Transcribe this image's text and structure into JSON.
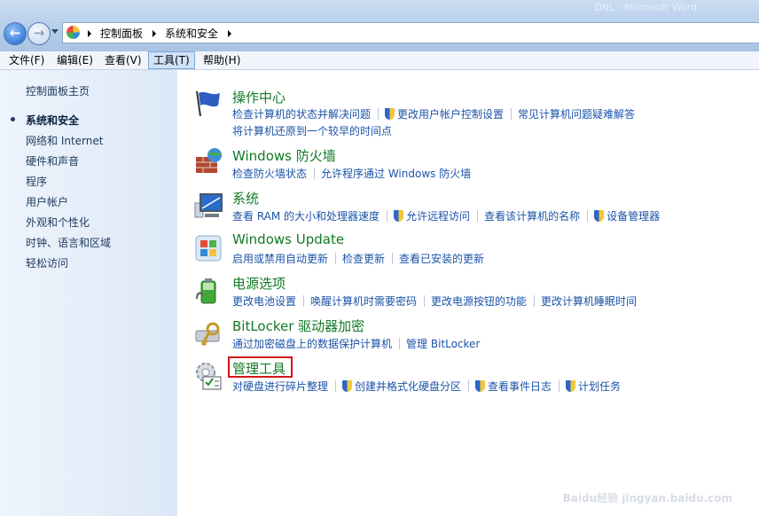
{
  "window": {
    "title_faded": "DNL - Microsoft Word"
  },
  "nav": {
    "back_label": "←",
    "forward_label": "→"
  },
  "breadcrumb": [
    "控制面板",
    "系统和安全"
  ],
  "menubar": [
    "文件(F)",
    "编辑(E)",
    "查看(V)",
    "工具(T)",
    "帮助(H)"
  ],
  "sidebar": {
    "home": "控制面板主页",
    "items": [
      "系统和安全",
      "网络和 Internet",
      "硬件和声音",
      "程序",
      "用户帐户",
      "外观和个性化",
      "时钟、语言和区域",
      "轻松访问"
    ]
  },
  "categories": [
    {
      "title": "操作中心",
      "icon": "action-center-flag-icon",
      "links": [
        "检查计算机的状态并解决问题",
        "更改用户帐户控制设置",
        "常见计算机问题疑难解答"
      ],
      "links2": [
        "将计算机还原到一个较早的时间点"
      ]
    },
    {
      "title": "Windows 防火墙",
      "icon": "firewall-icon",
      "links": [
        "检查防火墙状态",
        "允许程序通过 Windows 防火墙"
      ]
    },
    {
      "title": "系统",
      "icon": "system-computer-icon",
      "links": [
        "查看 RAM 的大小和处理器速度",
        "允许远程访问",
        "查看该计算机的名称",
        "设备管理器"
      ]
    },
    {
      "title": "Windows Update",
      "icon": "windows-update-icon",
      "links": [
        "启用或禁用自动更新",
        "检查更新",
        "查看已安装的更新"
      ]
    },
    {
      "title": "电源选项",
      "icon": "power-battery-icon",
      "links": [
        "更改电池设置",
        "唤醒计算机时需要密码",
        "更改电源按钮的功能",
        "更改计算机睡眠时间"
      ]
    },
    {
      "title": "BitLocker 驱动器加密",
      "icon": "bitlocker-key-icon",
      "links": [
        "通过加密磁盘上的数据保护计算机",
        "管理 BitLocker"
      ]
    },
    {
      "title": "管理工具",
      "icon": "admin-tools-icon",
      "links": [
        "对硬盘进行碎片整理",
        "创建并格式化硬盘分区",
        "查看事件日志",
        "计划任务"
      ]
    }
  ],
  "watermark": "Baidu经验 jingyan.baidu.com"
}
